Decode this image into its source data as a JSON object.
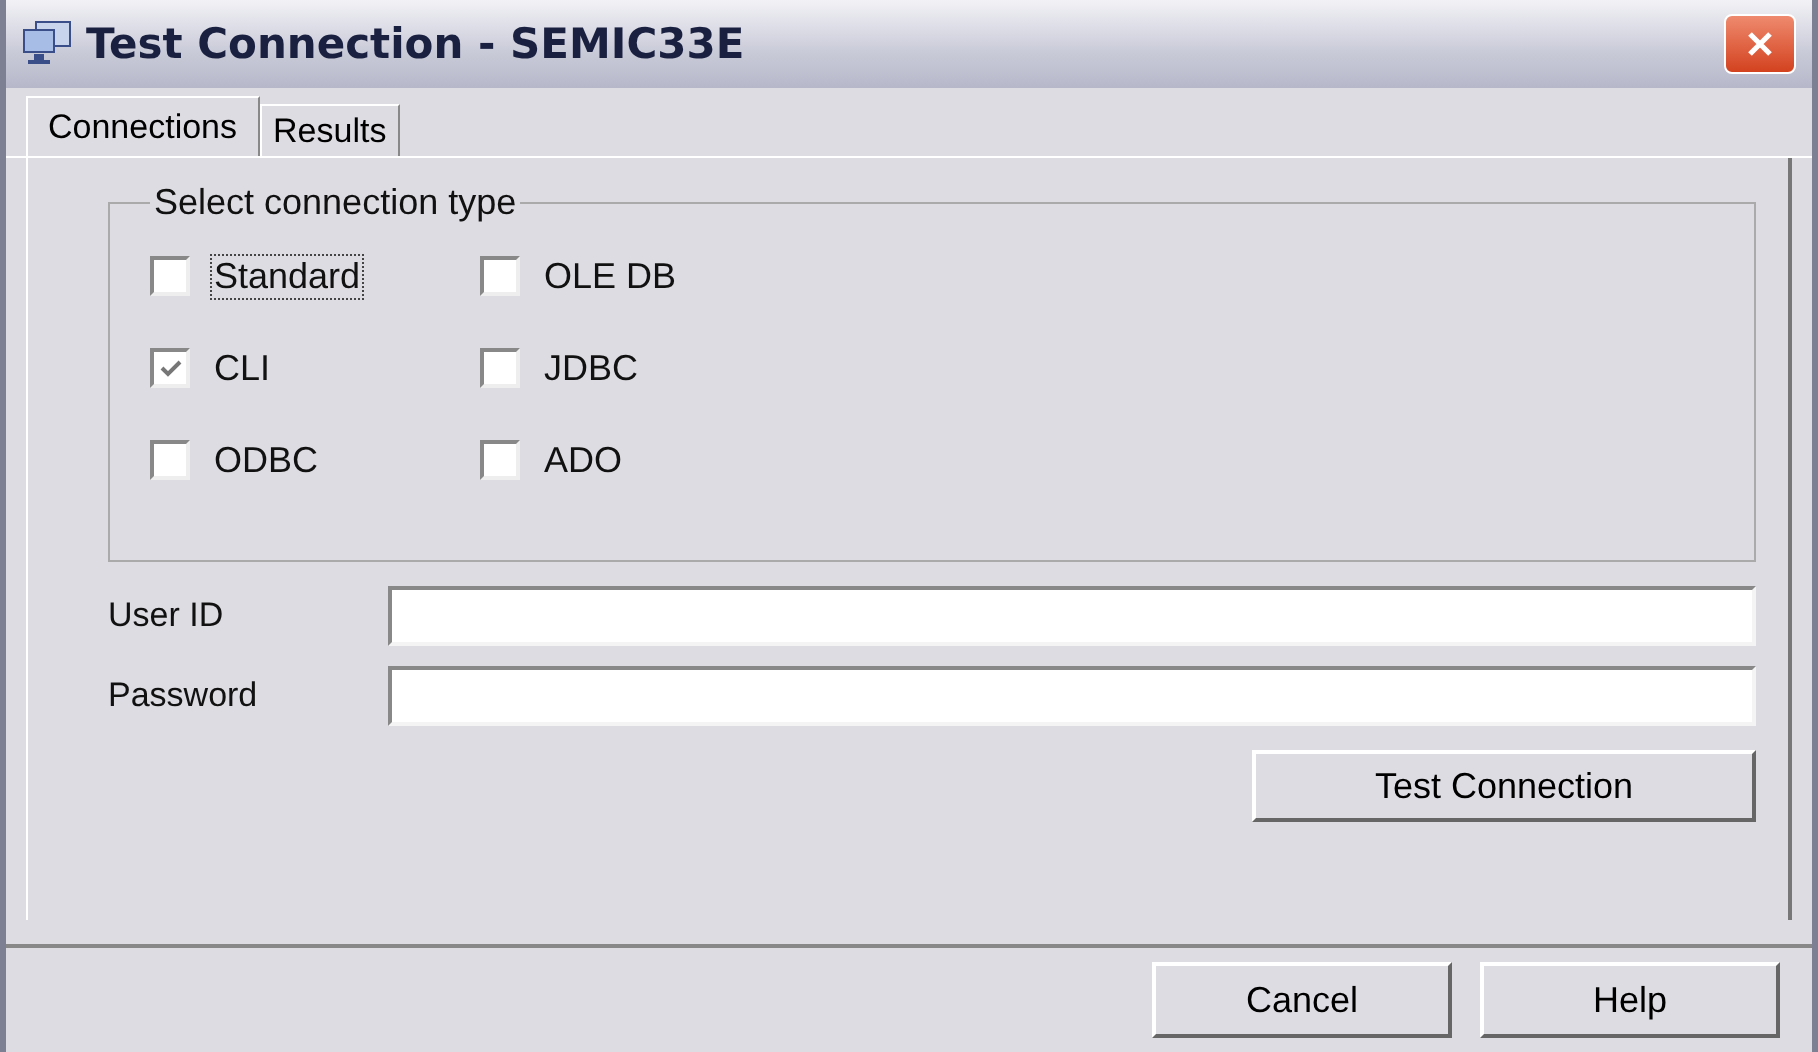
{
  "window": {
    "title": "Test Connection - SEMIC33E"
  },
  "tabs": [
    {
      "label": "Connections",
      "selected": true
    },
    {
      "label": "Results",
      "selected": false
    }
  ],
  "connection_type": {
    "legend": "Select connection type",
    "options": [
      {
        "label": "Standard",
        "checked": false,
        "focused": true
      },
      {
        "label": "OLE DB",
        "checked": false,
        "focused": false
      },
      {
        "label": "CLI",
        "checked": true,
        "focused": false
      },
      {
        "label": "JDBC",
        "checked": false,
        "focused": false
      },
      {
        "label": "ODBC",
        "checked": false,
        "focused": false
      },
      {
        "label": "ADO",
        "checked": false,
        "focused": false
      }
    ]
  },
  "fields": [
    {
      "label": "User ID"
    },
    {
      "label": "Password"
    }
  ],
  "test_button": "Test Connection",
  "buttons": [
    "Cancel",
    "Help"
  ]
}
